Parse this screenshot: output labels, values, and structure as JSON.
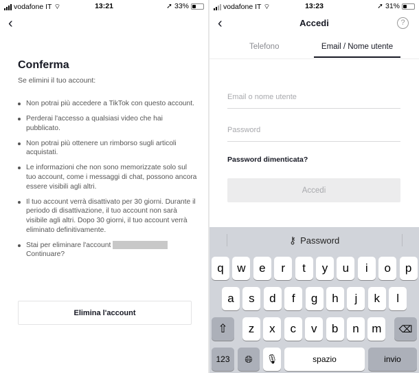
{
  "left": {
    "status": {
      "carrier": "vodafone IT",
      "time": "13:21",
      "battery": "33%",
      "battery_level": 0.33
    },
    "title": "Conferma",
    "subtitle": "Se elimini il tuo account:",
    "bullets": [
      "Non potrai più accedere a TikTok con questo account.",
      "Perderai l'accesso a qualsiasi video che hai pubblicato.",
      "Non potrai più ottenere un rimborso sugli articoli acquistati.",
      "Le informazioni che non sono memorizzate solo sul tuo account, come i messaggi di chat, possono ancora essere visibili agli altri.",
      "Il tuo account verrà disattivato per 30 giorni. Durante il periodo di disattivazione, il tuo account non sarà visibile agli altri. Dopo 30 giorni, il tuo account verrà eliminato definitivamente."
    ],
    "last_bullet_prefix": "Stai per eliminare l'account",
    "last_bullet_suffix": "Continuare?",
    "delete_button": "Elimina l'account"
  },
  "right": {
    "status": {
      "carrier": "vodafone IT",
      "time": "13:23",
      "battery": "31%",
      "battery_level": 0.31
    },
    "title": "Accedi",
    "tabs": [
      {
        "label": "Telefono",
        "active": false
      },
      {
        "label": "Email / Nome utente",
        "active": true
      }
    ],
    "email_placeholder": "Email o nome utente",
    "password_placeholder": "Password",
    "forgot": "Password dimenticata?",
    "login_button": "Accedi",
    "keyboard": {
      "suggestion": "Password",
      "row1": [
        "q",
        "w",
        "e",
        "r",
        "t",
        "y",
        "u",
        "i",
        "o",
        "p"
      ],
      "row2": [
        "a",
        "s",
        "d",
        "f",
        "g",
        "h",
        "j",
        "k",
        "l"
      ],
      "row3": [
        "z",
        "x",
        "c",
        "v",
        "b",
        "n",
        "m"
      ],
      "numbers": "123",
      "space": "spazio",
      "return": "invio"
    }
  }
}
